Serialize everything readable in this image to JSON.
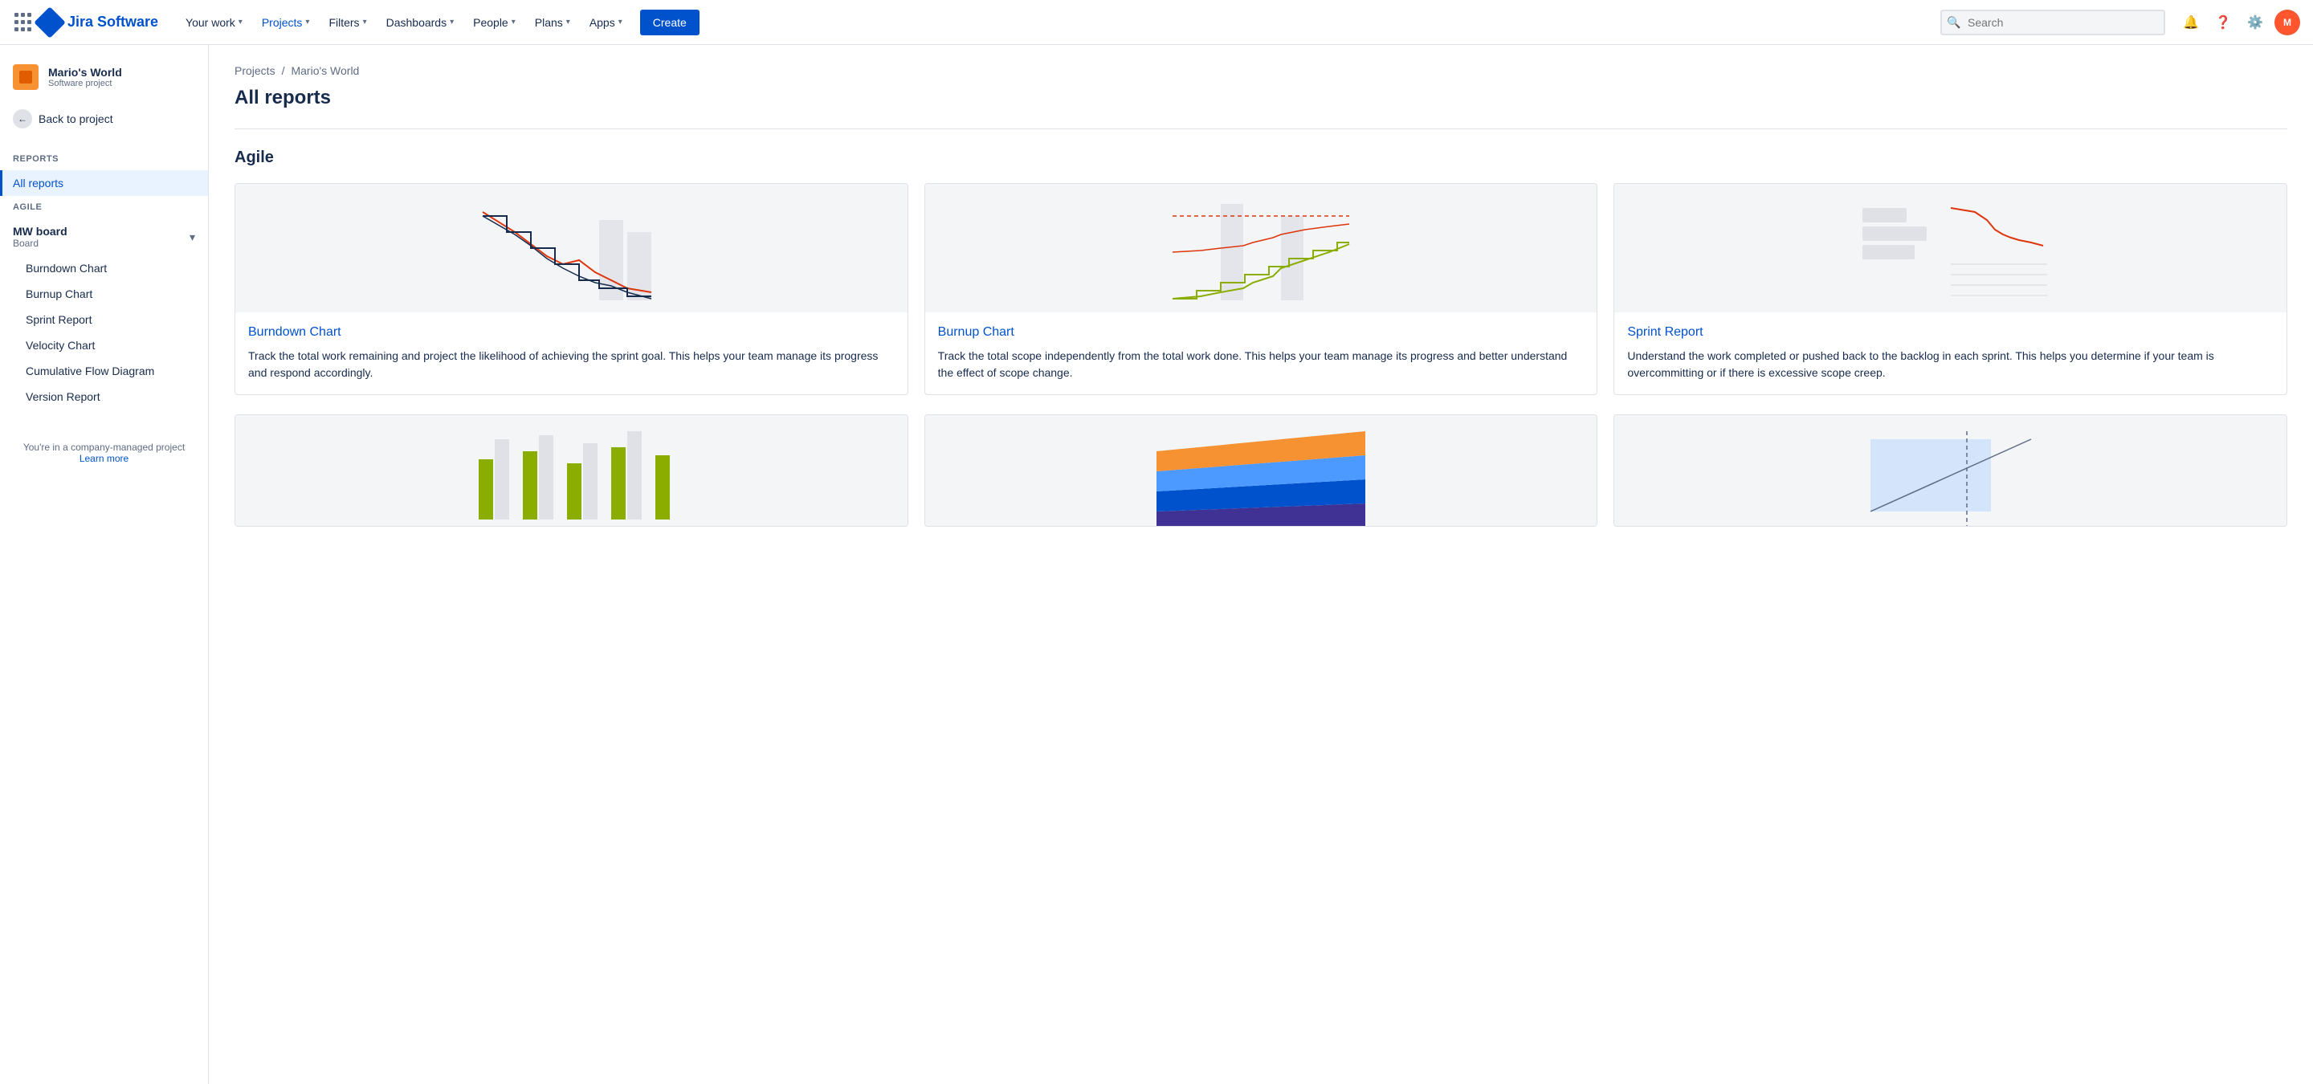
{
  "app": {
    "name": "Jira Software"
  },
  "nav": {
    "your_work": "Your work",
    "projects": "Projects",
    "filters": "Filters",
    "dashboards": "Dashboards",
    "people": "People",
    "plans": "Plans",
    "apps": "Apps",
    "create": "Create",
    "search_placeholder": "Search"
  },
  "sidebar": {
    "project_name": "Mario's World",
    "project_type": "Software project",
    "back_label": "Back to project",
    "reports_label": "Reports",
    "all_reports": "All reports",
    "section_agile": "AGILE",
    "board_name": "MW board",
    "board_type": "Board",
    "burndown_chart": "Burndown Chart",
    "burnup_chart": "Burnup Chart",
    "sprint_report": "Sprint Report",
    "velocity_chart": "Velocity Chart",
    "cumulative_flow": "Cumulative Flow Diagram",
    "version_report": "Version Report",
    "footer_text": "You're in a company-managed project",
    "learn_more": "Learn more"
  },
  "breadcrumb": {
    "projects": "Projects",
    "mario_world": "Mario's World"
  },
  "main": {
    "page_title": "All reports",
    "agile_section": "Agile",
    "burndown_chart": {
      "title": "Burndown Chart",
      "description": "Track the total work remaining and project the likelihood of achieving the sprint goal. This helps your team manage its progress and respond accordingly."
    },
    "burnup_chart": {
      "title": "Burnup Chart",
      "description": "Track the total scope independently from the total work done. This helps your team manage its progress and better understand the effect of scope change."
    },
    "sprint_report": {
      "title": "Sprint Report",
      "description": "Understand the work completed or pushed back to the backlog in each sprint. This helps you determine if your team is overcommitting or if there is excessive scope creep."
    }
  }
}
